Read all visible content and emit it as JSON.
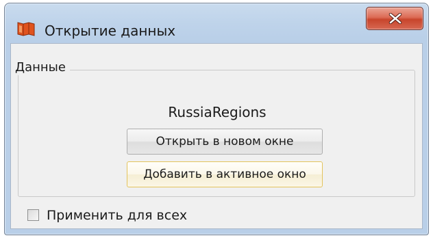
{
  "window": {
    "title": "Открытие данных",
    "app_icon": "map-book-icon",
    "close_icon": "close-x-icon",
    "accent_color": "#c8452c"
  },
  "group": {
    "label": "Данные"
  },
  "dataset": {
    "name": "RussiaRegions"
  },
  "buttons": {
    "open_new": "Открыть в новом окне",
    "add_active": "Добавить в активное окно"
  },
  "apply_all": {
    "label": "Применить для всех",
    "checked": false
  }
}
